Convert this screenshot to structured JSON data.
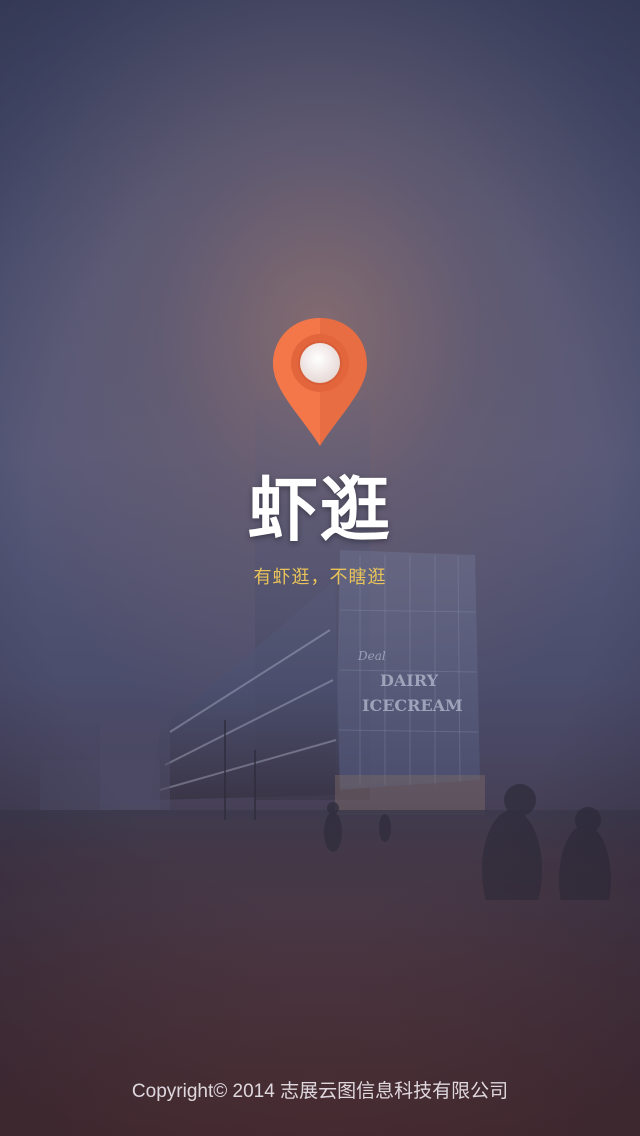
{
  "app": {
    "title": "虾逛",
    "tagline": "有虾逛，不瞎逛",
    "pin_icon": "location-pin-icon"
  },
  "background": {
    "building_sign_line1": "DAIRY",
    "building_sign_line2": "ICECREAM",
    "building_sign_small": "Deal"
  },
  "footer": {
    "copyright": "Copyright© 2014 志展云图信息科技有限公司"
  },
  "colors": {
    "pin_orange": "#f4774a",
    "pin_dark_orange": "#e2653c",
    "tagline_yellow": "#e9c35a",
    "title_white": "#ffffff"
  }
}
